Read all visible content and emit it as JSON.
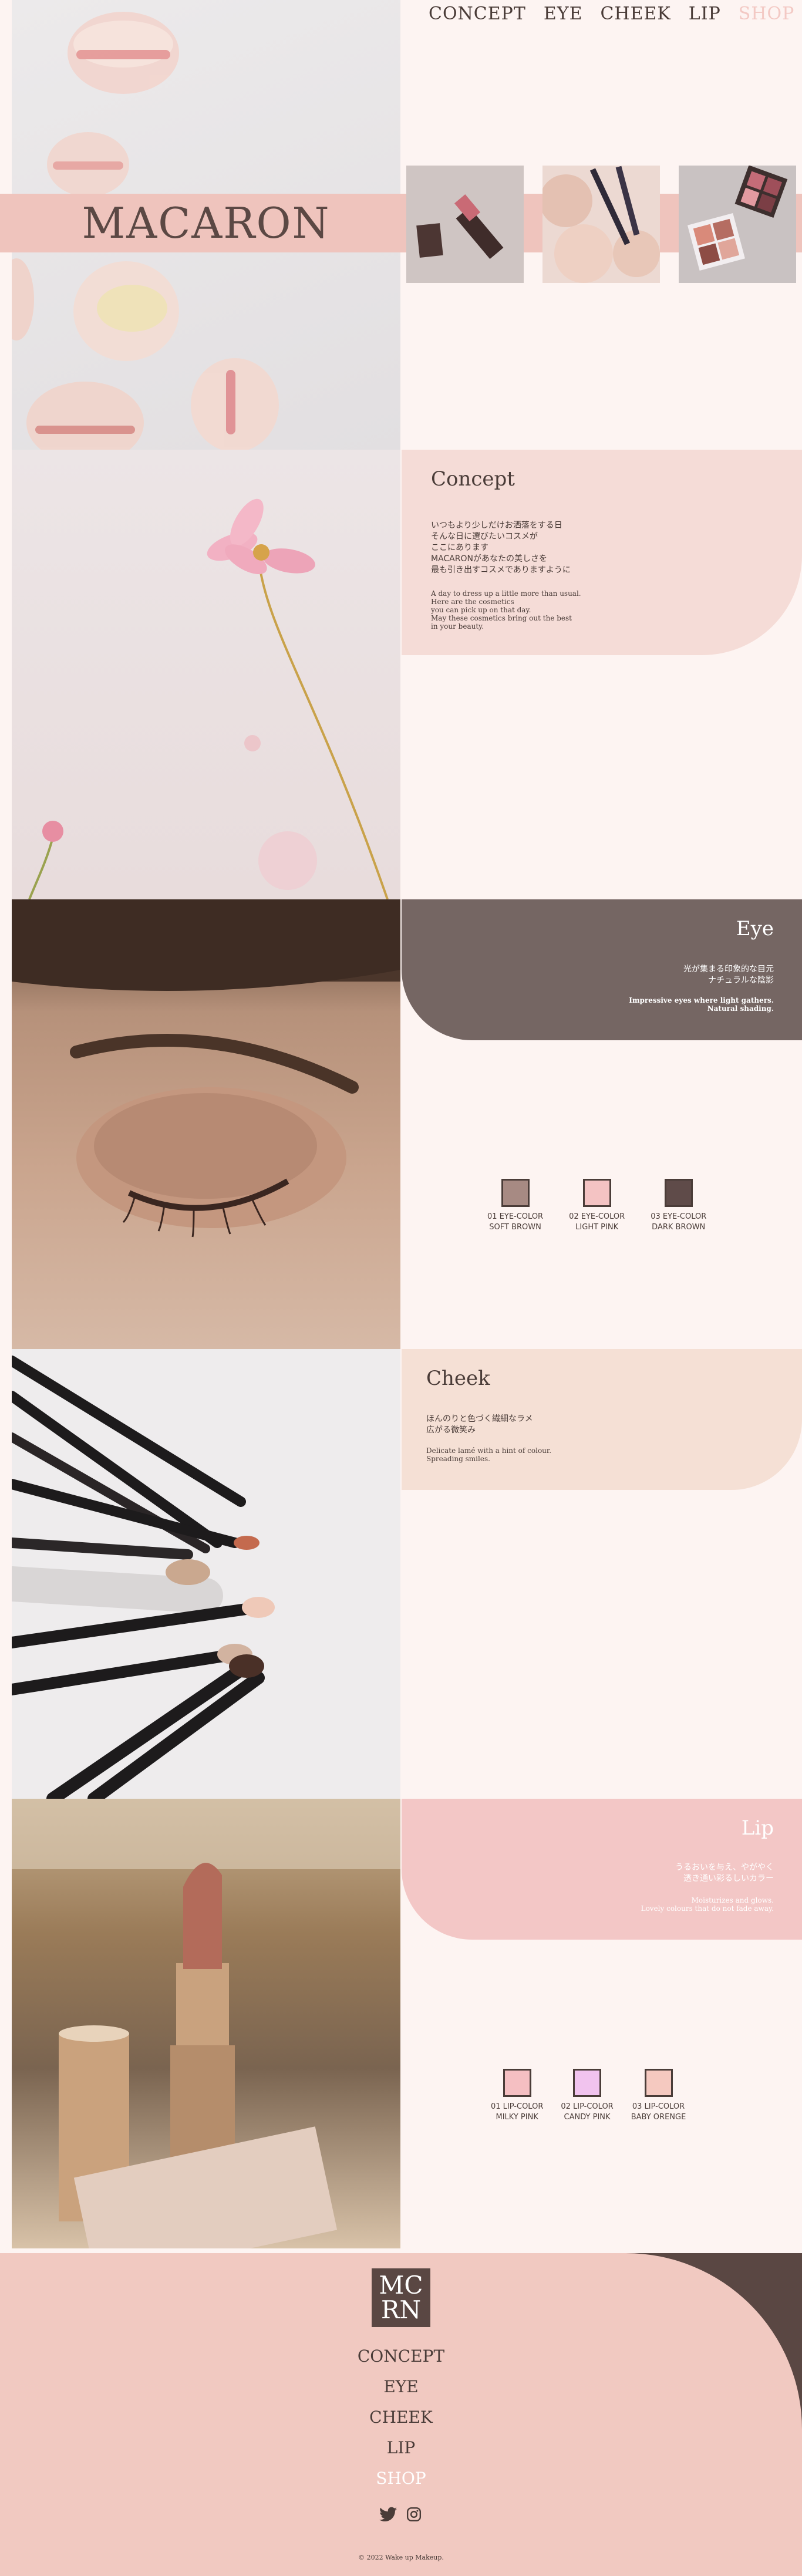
{
  "nav": {
    "concept": "CONCEPT",
    "eye": "EYE",
    "cheek": "CHEEK",
    "lip": "LIP",
    "shop": "SHOP"
  },
  "hero": {
    "brand": "MACARON"
  },
  "concept": {
    "title": "Concept",
    "jp": [
      "いつもより少しだけお洒落をする日",
      "そんな日に選びたいコスメが",
      "ここにあります",
      "MACARONがあなたの美しさを",
      "最も引き出すコスメでありますように"
    ],
    "en": [
      "A day to dress up a little more than usual.",
      "Here are the cosmetics",
      "you can pick up on that day.",
      "May these cosmetics bring out the best",
      "in your beauty."
    ]
  },
  "eye": {
    "title": "Eye",
    "jp": [
      "光が集まる印象的な目元",
      "ナチュラルな陰影"
    ],
    "en": [
      "Impressive eyes where light gathers.",
      "Natural shading."
    ],
    "swatches": [
      {
        "num": "01 EYE-COLOR",
        "name": "SOFT BROWN",
        "color": "#a78a83"
      },
      {
        "num": "02 EYE-COLOR",
        "name": "LIGHT PINK",
        "color": "#f4c3c3"
      },
      {
        "num": "03 EYE-COLOR",
        "name": "DARK BROWN",
        "color": "#5f4b49"
      }
    ]
  },
  "cheek": {
    "title": "Cheek",
    "jp": [
      "ほんのりと色づく繊細なラメ",
      "広がる微笑み"
    ],
    "en": [
      "Delicate lamé with a hint of colour.",
      "Spreading smiles."
    ]
  },
  "lip": {
    "title": "Lip",
    "jp": [
      "うるおいを与え、やがやく",
      "透き通い彩るしいカラー"
    ],
    "en": [
      "Moisturizes and glows.",
      "Lovely colours that do not fade away."
    ],
    "swatches": [
      {
        "num": "01 LIP-COLOR",
        "name": "MILKY PINK",
        "color": "#f5bfc2"
      },
      {
        "num": "02 LIP-COLOR",
        "name": "CANDY PINK",
        "color": "#f1c3ee"
      },
      {
        "num": "03 LIP-COLOR",
        "name": "BABY ORENGE",
        "color": "#f5c9c0"
      }
    ]
  },
  "footer": {
    "logo_top": "MC",
    "logo_bottom": "RN",
    "links": [
      "CONCEPT",
      "EYE",
      "CHEEK",
      "LIP",
      "SHOP"
    ],
    "copyright": "© 2022 Wake up Makeup."
  },
  "colors": {
    "background": "#fdf4f2",
    "accent": "#efc4bd",
    "dark": "#5a4743",
    "cheek_card": "#f5e0d5",
    "lip_card": "#f3c7c6",
    "concept_card": "#f5dcd7",
    "eye_card": "#756663"
  }
}
